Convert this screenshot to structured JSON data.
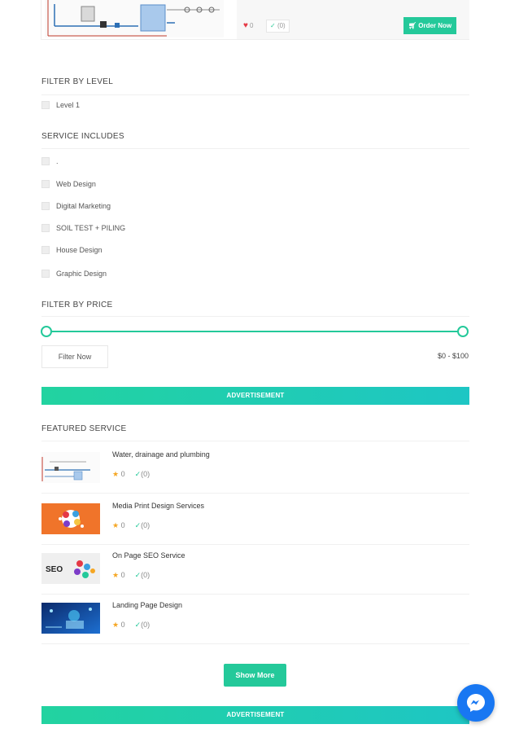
{
  "top_service": {
    "likes": "0",
    "reviews": "(0)",
    "order_label": "Order Now"
  },
  "filter_level": {
    "title": "FILTER BY LEVEL",
    "options": [
      "Level 1"
    ]
  },
  "service_includes": {
    "title": "SERVICE INCLUDES",
    "options": [
      ".",
      "Web Design",
      "Digital Marketing",
      "SOIL TEST + PILING",
      "House Design",
      "Graphic Design"
    ]
  },
  "filter_price": {
    "title": "FILTER BY PRICE",
    "min_value": 0,
    "max_value": 100,
    "button_label": "Filter Now",
    "range_text": "$0 - $100"
  },
  "advertisement_label": "ADVERTISEMENT",
  "featured": {
    "title": "FEATURED SERVICE",
    "items": [
      {
        "title": "Water, drainage and plumbing",
        "rating": "0",
        "reviews": "(0)"
      },
      {
        "title": "Media Print Design Services",
        "rating": "0",
        "reviews": "(0)"
      },
      {
        "title": "On Page SEO Service",
        "rating": "0",
        "reviews": "(0)"
      },
      {
        "title": "Landing Page Design",
        "rating": "0",
        "reviews": "(0)"
      }
    ],
    "seo_thumb_text": "SEO"
  },
  "show_more_label": "Show More",
  "colors": {
    "accent": "#24c99a",
    "messenger": "#1877f2",
    "heart": "#e53945",
    "star": "#f5a623"
  },
  "icons": [
    "heart-icon",
    "check-circle-icon",
    "cart-icon",
    "star-icon",
    "messenger-icon"
  ]
}
